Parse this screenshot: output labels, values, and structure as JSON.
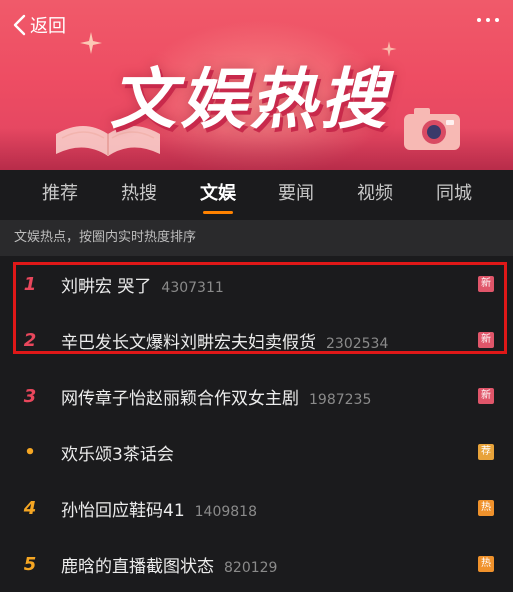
{
  "header": {
    "back_label": "返回",
    "banner_title": "文娱热搜"
  },
  "tabs": [
    {
      "label": "推荐",
      "active": false
    },
    {
      "label": "热搜",
      "active": false
    },
    {
      "label": "文娱",
      "active": true
    },
    {
      "label": "要闻",
      "active": false
    },
    {
      "label": "视频",
      "active": false
    },
    {
      "label": "同城",
      "active": false
    }
  ],
  "subheader": "文娱热点，按圈内实时热度排序",
  "accent_color": "#ff8200",
  "items": [
    {
      "rank": "1",
      "title": "刘畊宏 哭了",
      "count": "4307311",
      "badge": "新",
      "rank_color": "#e9475c",
      "badge_color": "#e0566a"
    },
    {
      "rank": "2",
      "title": "辛巴发长文爆料刘畊宏夫妇卖假货",
      "count": "2302534",
      "badge": "新",
      "rank_color": "#e9475c",
      "badge_color": "#e0566a"
    },
    {
      "rank": "3",
      "title": "网传章子怡赵丽颖合作双女主剧",
      "count": "1987235",
      "badge": "新",
      "rank_color": "#e9475c",
      "badge_color": "#e0566a"
    },
    {
      "rank": "•",
      "title": "欢乐颂3茶话会",
      "count": "",
      "badge": "荐",
      "rank_color": "#f5a623",
      "badge_color": "#e8a33a"
    },
    {
      "rank": "4",
      "title": "孙怡回应鞋码41",
      "count": "1409818",
      "badge": "热",
      "rank_color": "#f5a623",
      "badge_color": "#f0922c"
    },
    {
      "rank": "5",
      "title": "鹿晗的直播截图状态",
      "count": "820129",
      "badge": "热",
      "rank_color": "#f5a623",
      "badge_color": "#f0922c"
    }
  ]
}
